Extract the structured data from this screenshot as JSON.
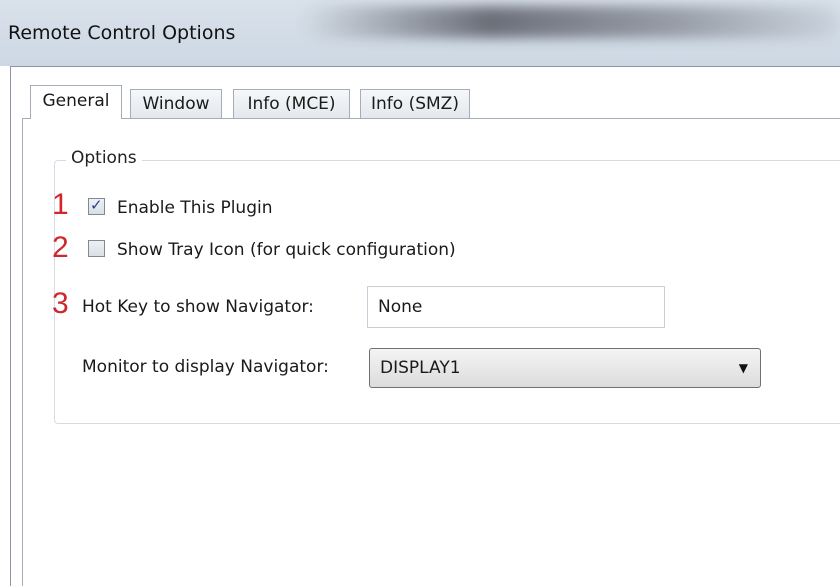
{
  "window": {
    "title": "Remote Control Options"
  },
  "tabs": [
    {
      "label": "General",
      "active": true
    },
    {
      "label": "Window",
      "active": false
    },
    {
      "label": "Info (MCE)",
      "active": false
    },
    {
      "label": "Info (SMZ)",
      "active": false
    }
  ],
  "options_group": {
    "label": "Options",
    "annotations": [
      "1",
      "2",
      "3"
    ],
    "enable_plugin": {
      "label": "Enable This Plugin",
      "checked": true
    },
    "show_tray_icon": {
      "label": "Show Tray Icon (for quick configuration)",
      "checked": false
    },
    "hot_key": {
      "label": "Hot Key to show Navigator:",
      "value": "None"
    },
    "monitor": {
      "label": "Monitor to display Navigator:",
      "selected": "DISPLAY1"
    }
  },
  "colors": {
    "annotation": "#d0262d",
    "check": "#2a3d8f"
  }
}
